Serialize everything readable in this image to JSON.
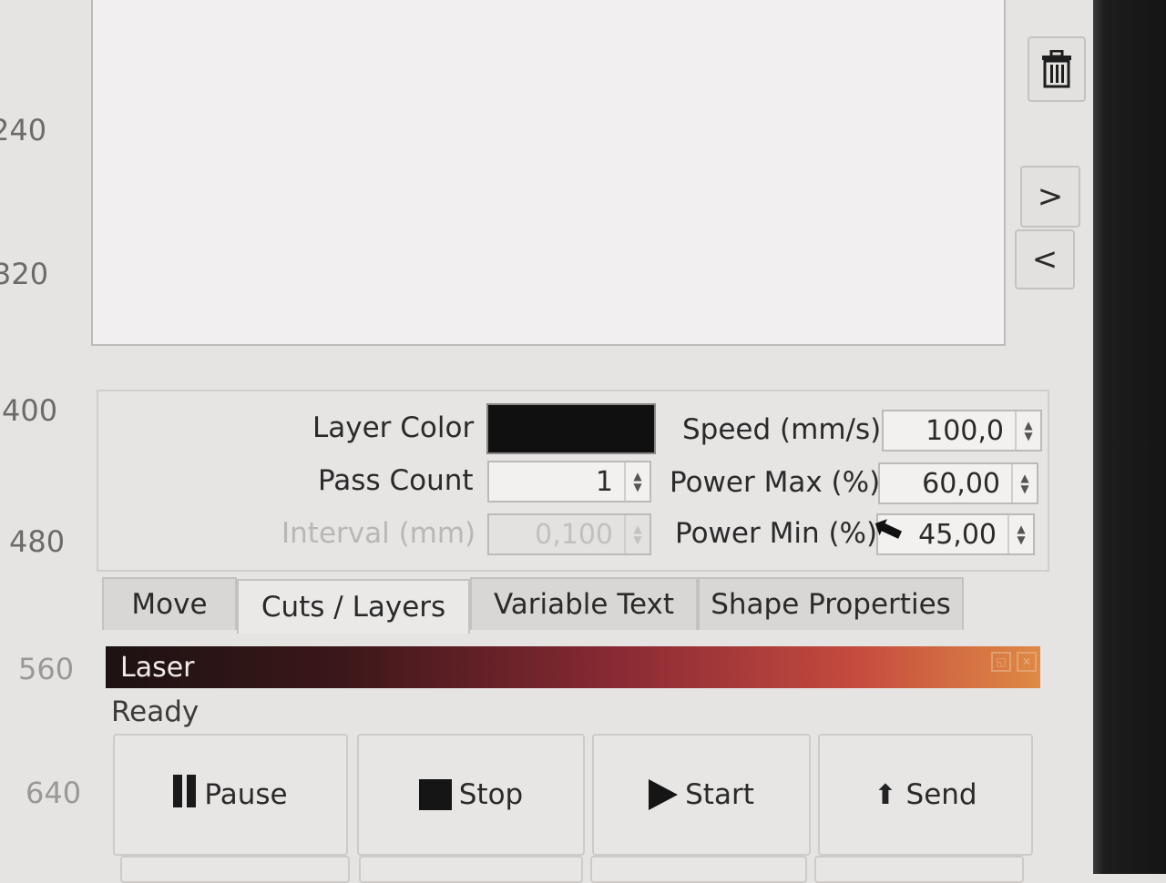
{
  "ruler": {
    "labels": [
      "240",
      "320",
      "400",
      "480",
      "560",
      "640"
    ]
  },
  "sidebar_buttons": {
    "delete_icon": "trash-icon",
    "next_icon": "chevron-right-icon",
    "prev_icon": "chevron-left-icon",
    "next_glyph": ">",
    "prev_glyph": "<"
  },
  "layer_settings": {
    "layer_color_label": "Layer Color",
    "layer_color_value": "#101010",
    "pass_count_label": "Pass Count",
    "pass_count_value": "1",
    "interval_label": "Interval (mm)",
    "interval_value": "0,100",
    "speed_label": "Speed (mm/s)",
    "speed_value": "100,0",
    "power_max_label": "Power Max (%)",
    "power_max_value": "60,00",
    "power_min_label": "Power Min (%)",
    "power_min_value": "45,00"
  },
  "tabs": [
    {
      "label": "Move"
    },
    {
      "label": "Cuts / Layers"
    },
    {
      "label": "Variable Text"
    },
    {
      "label": "Shape Properties"
    }
  ],
  "laser_panel": {
    "title": "Laser",
    "status": "Ready",
    "buttons": {
      "pause": "Pause",
      "stop": "Stop",
      "start": "Start",
      "send": "Send"
    }
  }
}
